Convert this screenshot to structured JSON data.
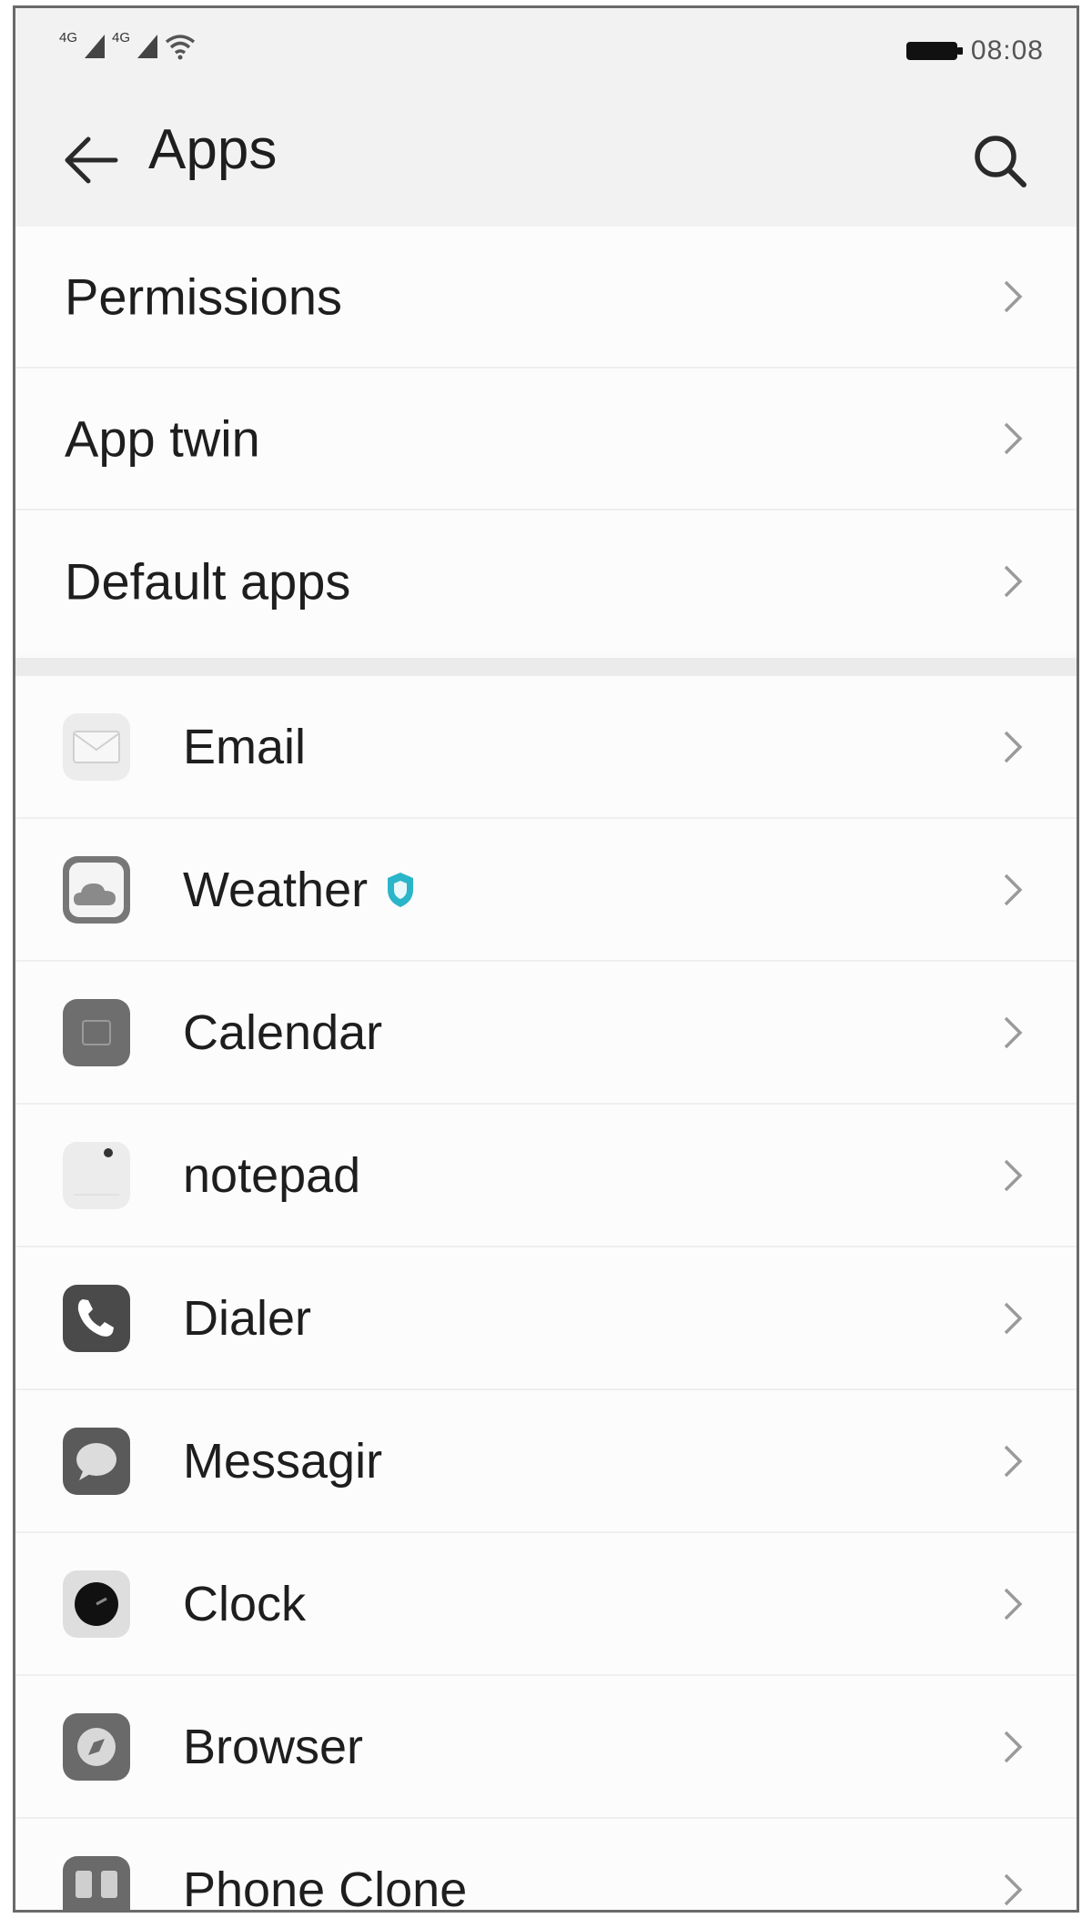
{
  "status_bar": {
    "signal_labels": [
      "4G",
      "4G"
    ],
    "time": "08:08"
  },
  "header": {
    "title": "Apps"
  },
  "settings": [
    {
      "label": "Permissions"
    },
    {
      "label": "App twin"
    },
    {
      "label": "Default apps"
    }
  ],
  "apps": [
    {
      "label": "Email",
      "icon": "email-icon"
    },
    {
      "label": "Weather",
      "icon": "weather-icon",
      "badge": "shield-badge-icon"
    },
    {
      "label": "Calendar",
      "icon": "calendar-icon"
    },
    {
      "label": "notepad",
      "icon": "notepad-icon"
    },
    {
      "label": "Dialer",
      "icon": "dialer-icon"
    },
    {
      "label": "Messagir",
      "icon": "messaging-icon"
    },
    {
      "label": "Clock",
      "icon": "clock-icon"
    },
    {
      "label": "Browser",
      "icon": "browser-icon"
    },
    {
      "label": "Phone Clone",
      "icon": "phone-clone-icon"
    }
  ],
  "colors": {
    "text": "#1e1e1e",
    "chevron": "#9a9a9a",
    "badge": "#2bb5c9"
  }
}
